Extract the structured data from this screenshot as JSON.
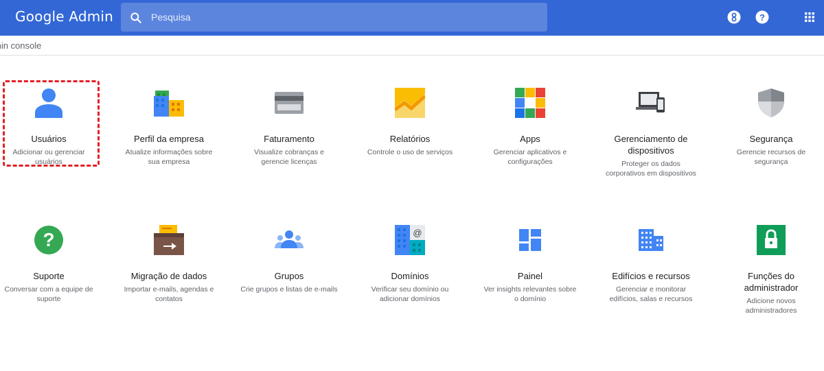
{
  "header": {
    "logo": "Google Admin",
    "search_placeholder": "Pesquisa"
  },
  "breadcrumb": "min console",
  "icons": {
    "search": "search-icon",
    "support_toolbar": "support-toolbar-icon",
    "help": "help-icon",
    "apps_grid": "apps-grid-icon"
  },
  "colors": {
    "topbar": "#3367d6",
    "search_bg": "#5c85de",
    "highlight": "#e31e24"
  },
  "cards": [
    {
      "title": "Usuários",
      "desc": "Adicionar ou gerenciar usuários"
    },
    {
      "title": "Perfil da empresa",
      "desc": "Atualize informações sobre sua empresa"
    },
    {
      "title": "Faturamento",
      "desc": "Visualize cobranças e gerencie licenças"
    },
    {
      "title": "Relatórios",
      "desc": "Controle o uso de serviços"
    },
    {
      "title": "Apps",
      "desc": "Gerenciar aplicativos e configurações"
    },
    {
      "title": "Gerenciamento de dispositivos",
      "desc": "Proteger os dados corporativos em dispositivos"
    },
    {
      "title": "Segurança",
      "desc": "Gerencie recursos de segurança"
    },
    {
      "title": "Suporte",
      "desc": "Conversar com a equipe de suporte"
    },
    {
      "title": "Migração de dados",
      "desc": "Importar e-mails, agendas e contatos"
    },
    {
      "title": "Grupos",
      "desc": "Crie grupos e listas de e-mails"
    },
    {
      "title": "Domínios",
      "desc": "Verificar seu domínio ou adicionar domínios"
    },
    {
      "title": "Painel",
      "desc": "Ver insights relevantes sobre o domínio"
    },
    {
      "title": "Edifícios e recursos",
      "desc": "Gerenciar e monitorar edifícios, salas e recursos"
    },
    {
      "title": "Funções do administrador",
      "desc": "Adicione novos administradores"
    }
  ]
}
